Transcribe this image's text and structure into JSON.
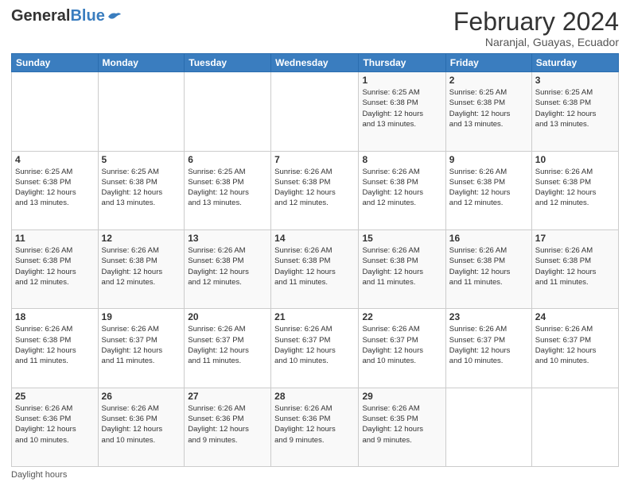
{
  "header": {
    "logo_general": "General",
    "logo_blue": "Blue",
    "month_title": "February 2024",
    "subtitle": "Naranjal, Guayas, Ecuador"
  },
  "days_of_week": [
    "Sunday",
    "Monday",
    "Tuesday",
    "Wednesday",
    "Thursday",
    "Friday",
    "Saturday"
  ],
  "footer_label": "Daylight hours",
  "weeks": [
    [
      {
        "day": "",
        "info": ""
      },
      {
        "day": "",
        "info": ""
      },
      {
        "day": "",
        "info": ""
      },
      {
        "day": "",
        "info": ""
      },
      {
        "day": "1",
        "info": "Sunrise: 6:25 AM\nSunset: 6:38 PM\nDaylight: 12 hours\nand 13 minutes."
      },
      {
        "day": "2",
        "info": "Sunrise: 6:25 AM\nSunset: 6:38 PM\nDaylight: 12 hours\nand 13 minutes."
      },
      {
        "day": "3",
        "info": "Sunrise: 6:25 AM\nSunset: 6:38 PM\nDaylight: 12 hours\nand 13 minutes."
      }
    ],
    [
      {
        "day": "4",
        "info": "Sunrise: 6:25 AM\nSunset: 6:38 PM\nDaylight: 12 hours\nand 13 minutes."
      },
      {
        "day": "5",
        "info": "Sunrise: 6:25 AM\nSunset: 6:38 PM\nDaylight: 12 hours\nand 13 minutes."
      },
      {
        "day": "6",
        "info": "Sunrise: 6:25 AM\nSunset: 6:38 PM\nDaylight: 12 hours\nand 13 minutes."
      },
      {
        "day": "7",
        "info": "Sunrise: 6:26 AM\nSunset: 6:38 PM\nDaylight: 12 hours\nand 12 minutes."
      },
      {
        "day": "8",
        "info": "Sunrise: 6:26 AM\nSunset: 6:38 PM\nDaylight: 12 hours\nand 12 minutes."
      },
      {
        "day": "9",
        "info": "Sunrise: 6:26 AM\nSunset: 6:38 PM\nDaylight: 12 hours\nand 12 minutes."
      },
      {
        "day": "10",
        "info": "Sunrise: 6:26 AM\nSunset: 6:38 PM\nDaylight: 12 hours\nand 12 minutes."
      }
    ],
    [
      {
        "day": "11",
        "info": "Sunrise: 6:26 AM\nSunset: 6:38 PM\nDaylight: 12 hours\nand 12 minutes."
      },
      {
        "day": "12",
        "info": "Sunrise: 6:26 AM\nSunset: 6:38 PM\nDaylight: 12 hours\nand 12 minutes."
      },
      {
        "day": "13",
        "info": "Sunrise: 6:26 AM\nSunset: 6:38 PM\nDaylight: 12 hours\nand 12 minutes."
      },
      {
        "day": "14",
        "info": "Sunrise: 6:26 AM\nSunset: 6:38 PM\nDaylight: 12 hours\nand 11 minutes."
      },
      {
        "day": "15",
        "info": "Sunrise: 6:26 AM\nSunset: 6:38 PM\nDaylight: 12 hours\nand 11 minutes."
      },
      {
        "day": "16",
        "info": "Sunrise: 6:26 AM\nSunset: 6:38 PM\nDaylight: 12 hours\nand 11 minutes."
      },
      {
        "day": "17",
        "info": "Sunrise: 6:26 AM\nSunset: 6:38 PM\nDaylight: 12 hours\nand 11 minutes."
      }
    ],
    [
      {
        "day": "18",
        "info": "Sunrise: 6:26 AM\nSunset: 6:38 PM\nDaylight: 12 hours\nand 11 minutes."
      },
      {
        "day": "19",
        "info": "Sunrise: 6:26 AM\nSunset: 6:37 PM\nDaylight: 12 hours\nand 11 minutes."
      },
      {
        "day": "20",
        "info": "Sunrise: 6:26 AM\nSunset: 6:37 PM\nDaylight: 12 hours\nand 11 minutes."
      },
      {
        "day": "21",
        "info": "Sunrise: 6:26 AM\nSunset: 6:37 PM\nDaylight: 12 hours\nand 10 minutes."
      },
      {
        "day": "22",
        "info": "Sunrise: 6:26 AM\nSunset: 6:37 PM\nDaylight: 12 hours\nand 10 minutes."
      },
      {
        "day": "23",
        "info": "Sunrise: 6:26 AM\nSunset: 6:37 PM\nDaylight: 12 hours\nand 10 minutes."
      },
      {
        "day": "24",
        "info": "Sunrise: 6:26 AM\nSunset: 6:37 PM\nDaylight: 12 hours\nand 10 minutes."
      }
    ],
    [
      {
        "day": "25",
        "info": "Sunrise: 6:26 AM\nSunset: 6:36 PM\nDaylight: 12 hours\nand 10 minutes."
      },
      {
        "day": "26",
        "info": "Sunrise: 6:26 AM\nSunset: 6:36 PM\nDaylight: 12 hours\nand 10 minutes."
      },
      {
        "day": "27",
        "info": "Sunrise: 6:26 AM\nSunset: 6:36 PM\nDaylight: 12 hours\nand 9 minutes."
      },
      {
        "day": "28",
        "info": "Sunrise: 6:26 AM\nSunset: 6:36 PM\nDaylight: 12 hours\nand 9 minutes."
      },
      {
        "day": "29",
        "info": "Sunrise: 6:26 AM\nSunset: 6:35 PM\nDaylight: 12 hours\nand 9 minutes."
      },
      {
        "day": "",
        "info": ""
      },
      {
        "day": "",
        "info": ""
      }
    ]
  ]
}
